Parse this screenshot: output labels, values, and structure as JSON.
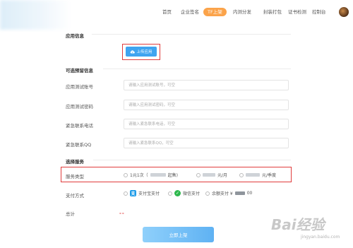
{
  "nav": {
    "items": [
      {
        "label": "首页"
      },
      {
        "label": "企业签名"
      },
      {
        "label": "TF上架",
        "active": true
      },
      {
        "label": "内测分发"
      },
      {
        "label": "封装打包"
      },
      {
        "label": "证书检测"
      },
      {
        "label": "控制台"
      }
    ]
  },
  "app_info": {
    "section_title": "应用信息",
    "upload_button": "上传应用"
  },
  "optional_info": {
    "section_title": "可选预留信息",
    "fields": [
      {
        "label": "应用测试账号",
        "placeholder": "请输入应用测试账号，可空"
      },
      {
        "label": "应用测试密码",
        "placeholder": "请输入应用测试密码，可空"
      },
      {
        "label": "紧急联系电话",
        "placeholder": "请输入紧急联系电话，可空"
      },
      {
        "label": "紧急联系QQ",
        "placeholder": "请输入紧急联系QQ，可空"
      }
    ]
  },
  "service": {
    "section_title": "选择服务",
    "type_label": "服务类型",
    "options": [
      {
        "prefix": "1元1次（",
        "suffix": "起售)"
      },
      {
        "suffix": "元/月"
      },
      {
        "suffix": "元/季度"
      }
    ]
  },
  "payment": {
    "label": "支付方式",
    "alipay": "支付宝支付",
    "wechat": "微信支付",
    "balance": "余额支付 ¥",
    "balance_tail": "00"
  },
  "total": {
    "label": "总计",
    "value": "--"
  },
  "submit_button": "立即上架",
  "watermark": {
    "main": "Bai经验",
    "sub": "jingyan.baidu.com"
  },
  "colors": {
    "accent_orange": "#fba34a",
    "upload_blue": "#3fa4f0",
    "highlight_red": "#e03c3c",
    "alipay_blue": "#1a9ae8",
    "wechat_green": "#2db84d"
  }
}
